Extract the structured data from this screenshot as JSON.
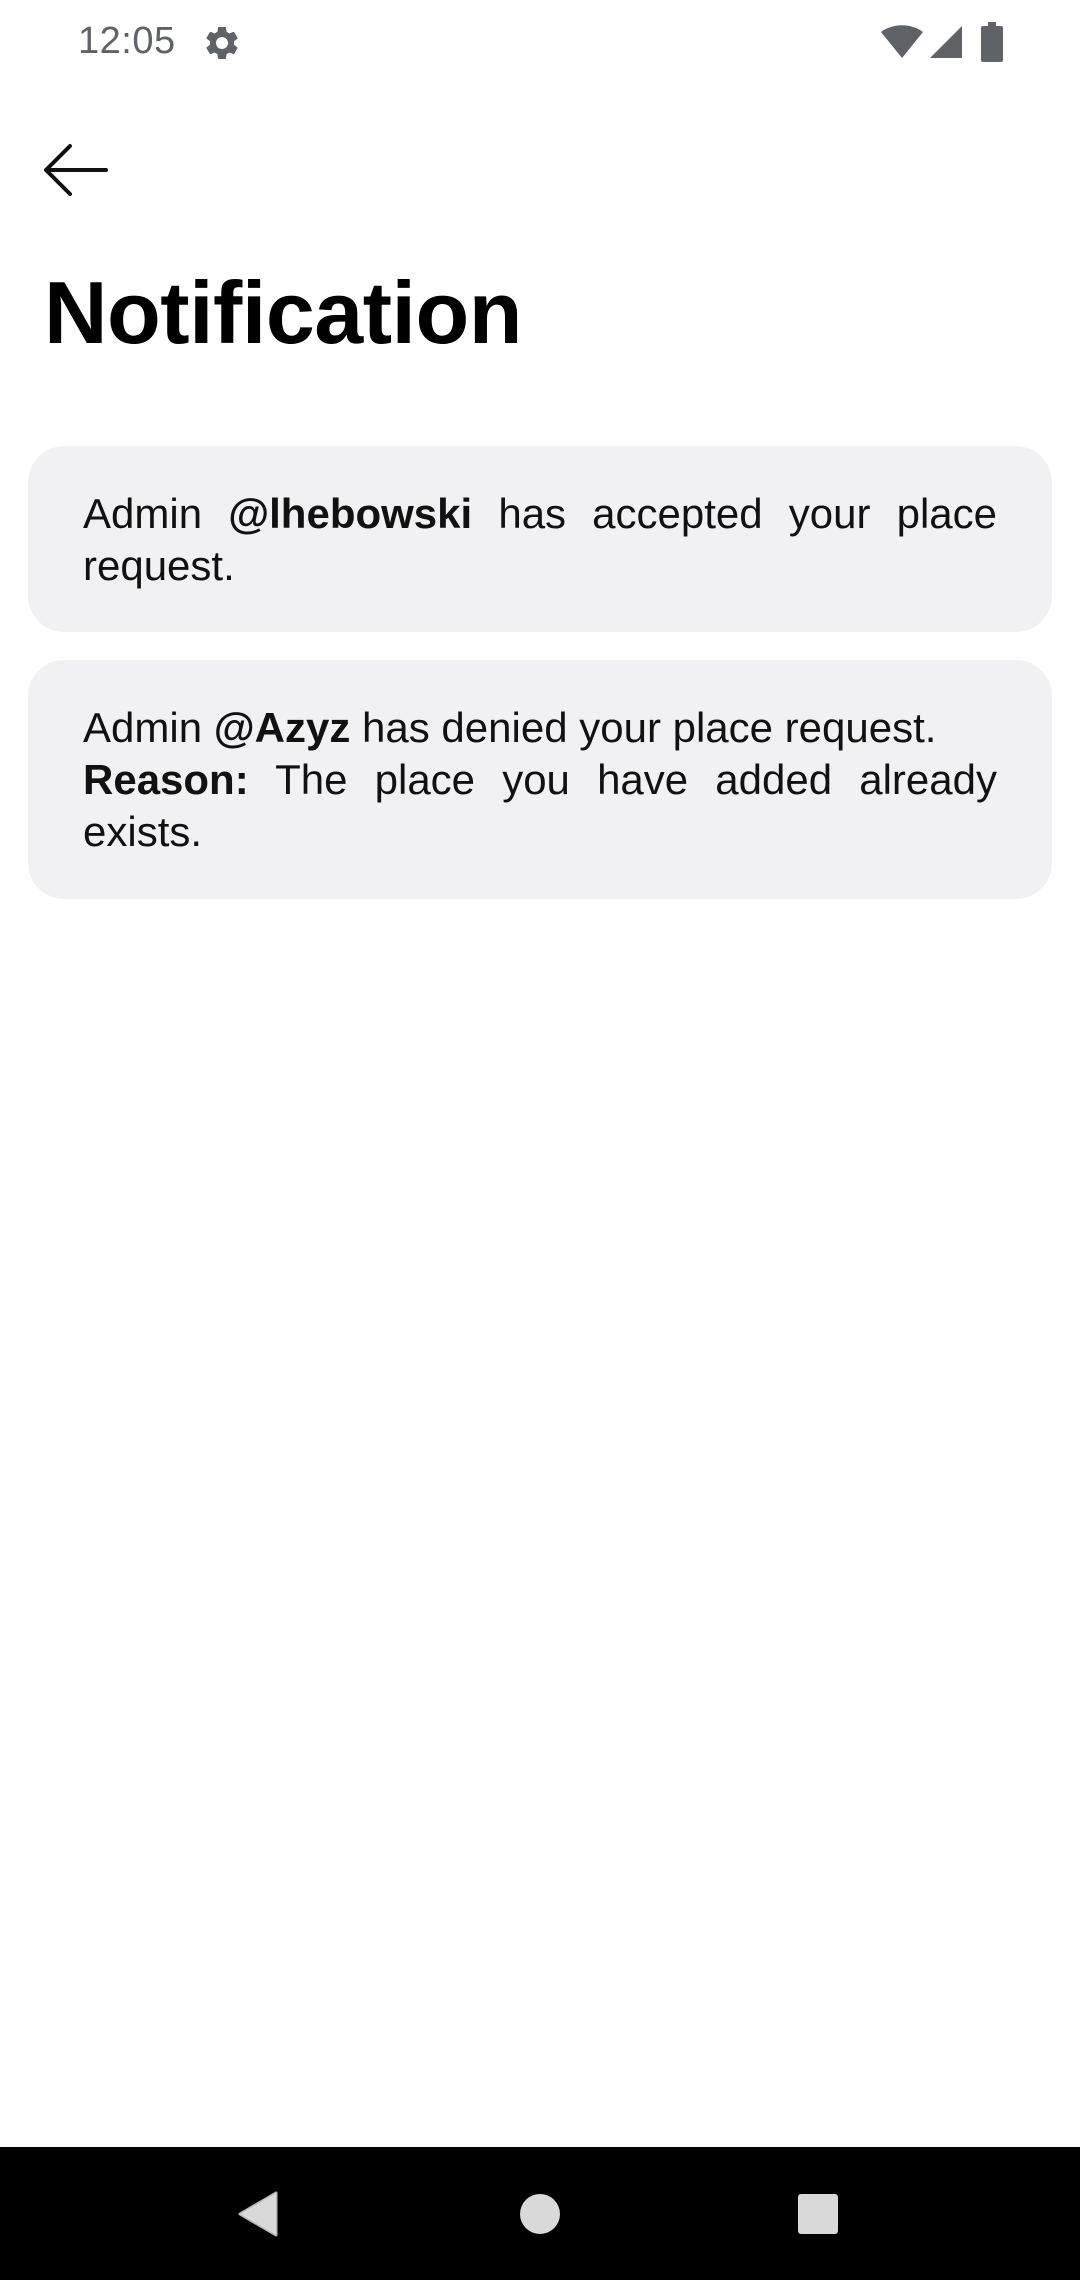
{
  "status_bar": {
    "time": "12:05",
    "settings_icon": "gear-icon",
    "wifi_icon": "wifi-icon",
    "signal_icon": "signal-icon",
    "battery_icon": "battery-icon"
  },
  "header": {
    "back_icon": "arrow-left-icon",
    "title": "Notification"
  },
  "notifications": [
    {
      "prefix": "Admin ",
      "user": "@lhebowski",
      "suffix": " has accepted your place request."
    },
    {
      "prefix": "Admin ",
      "user": "@Azyz",
      "suffix": " has denied your place request.",
      "reason_label": "Reason:",
      "reason_text": " The place you have added already exists."
    }
  ],
  "nav_bar": {
    "back_icon": "triangle-back-icon",
    "home_icon": "circle-home-icon",
    "recents_icon": "square-recents-icon"
  },
  "colors": {
    "card_background": "#f1f1f3",
    "status_icons": "#5f6368",
    "nav_background": "#000000"
  }
}
